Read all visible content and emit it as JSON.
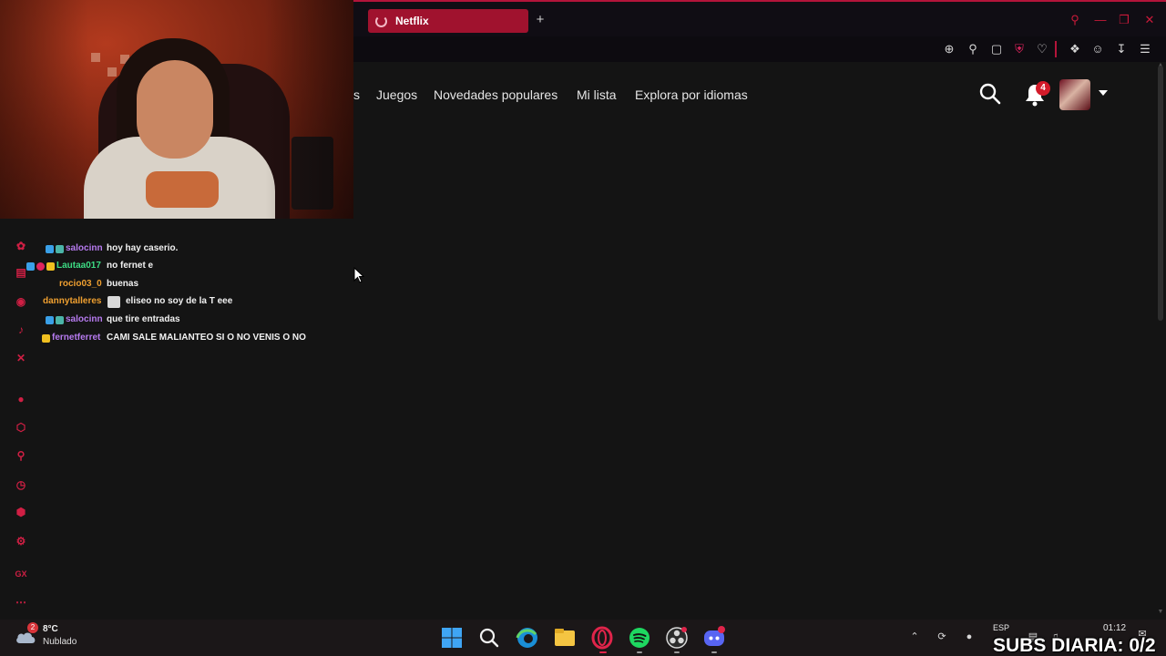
{
  "browser": {
    "tab_title": "Netflix",
    "new_tab": "+"
  },
  "netflix": {
    "nav_items": [
      "s",
      "Juegos",
      "Novedades populares",
      "Mi lista",
      "Explora por idiomas"
    ],
    "notification_count": "4"
  },
  "chat": {
    "messages": [
      {
        "user": "salocinn",
        "text": "hoy hay caserio.",
        "user_color": "#b77bf0"
      },
      {
        "user": "Lautaa017",
        "text": "no fernet e",
        "user_color": "#3ddc84"
      },
      {
        "user": "rocio03_0",
        "text": "buenas",
        "user_color": "#f0a030"
      },
      {
        "user": "dannytalleres",
        "text": "eliseo no soy de la T eee",
        "user_color": "#f0a030"
      },
      {
        "user": "salocinn",
        "text": "que tire entradas",
        "user_color": "#b77bf0"
      },
      {
        "user": "fernetferret",
        "text": "CAMI SALE MALIANTEO SI O NO VENIS O NO",
        "user_color": "#b77bf0"
      }
    ]
  },
  "taskbar": {
    "weather_badge": "2",
    "temperature": "8°C",
    "weather": "Nublado",
    "language": "ESP",
    "time": "01:12",
    "subs_overlay": "SUBS DIARIA: 0/2"
  },
  "colors": {
    "opera_red": "#d01f44",
    "netflix_bg": "#141414",
    "tab_red": "#a0122e"
  }
}
